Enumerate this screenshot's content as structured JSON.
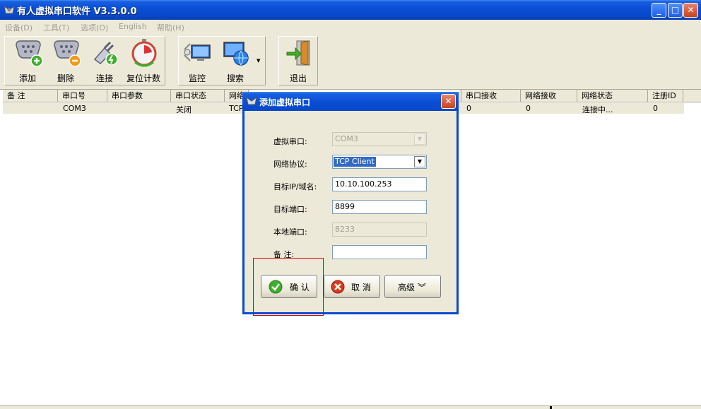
{
  "window": {
    "title": "有人虚拟串口软件  V3.3.0.0",
    "minimize": "_",
    "maximize": "□",
    "close": "✕"
  },
  "menu": [
    "设备(D)",
    "工具(T)",
    "选项(O)",
    "English",
    "帮助(H)"
  ],
  "toolbar": {
    "add": "添加",
    "delete": "删除",
    "connect": "连接",
    "reset_count": "复位计数",
    "monitor": "监控",
    "search": "搜索",
    "exit": "退出"
  },
  "table": {
    "columns": [
      "备 注",
      "串口号",
      "串口参数",
      "串口状态",
      "网络",
      "串口接收",
      "网络接收",
      "网络状态",
      "注册ID"
    ],
    "rows": [
      {
        "note": "",
        "port": "COM3",
        "params": "",
        "status": "关闭",
        "net": "TCP",
        "serial_rx": "0",
        "net_rx": "0",
        "net_status": "连接中...",
        "reg_id": "0"
      }
    ]
  },
  "dialog": {
    "title": "添加虚拟串口",
    "close": "✕",
    "fields": {
      "virtual_port_label": "虚拟串口:",
      "virtual_port_value": "COM3",
      "protocol_label": "网络协议:",
      "protocol_value": "TCP Client",
      "target_ip_label": "目标IP/域名:",
      "target_ip_value": "10.10.100.253",
      "target_port_label": "目标端口:",
      "target_port_value": "8899",
      "local_port_label": "本地端口:",
      "local_port_value": "8233",
      "note_label": "备  注:",
      "note_value": ""
    },
    "buttons": {
      "ok": "确 认",
      "cancel": "取 消",
      "advanced": "高级 ︾"
    }
  },
  "colors": {
    "titlebar": "#0a4fd6",
    "face": "#ece9d8",
    "selection": "#316ac5",
    "focus_outline": "#d00000"
  }
}
